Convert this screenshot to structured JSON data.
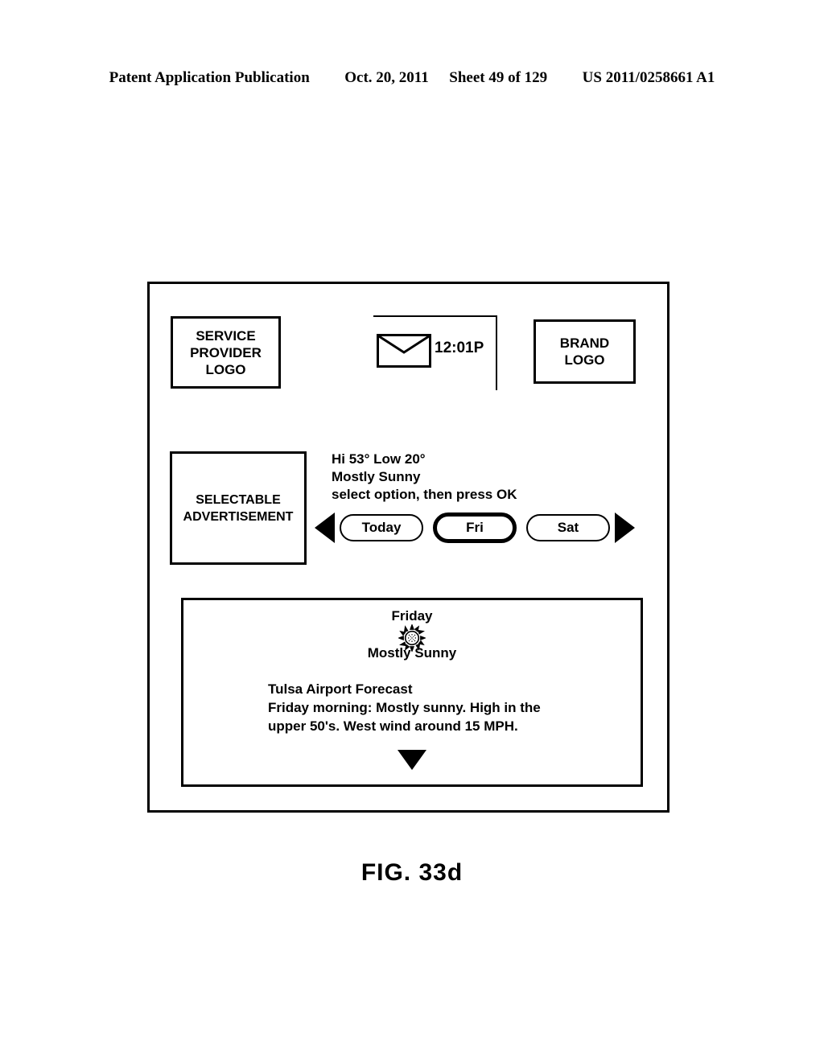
{
  "patent_header": {
    "publication": "Patent Application Publication",
    "date": "Oct. 20, 2011",
    "sheet": "Sheet 49 of 129",
    "number": "US 2011/0258661 A1"
  },
  "figure": {
    "caption": "FIG. 33d"
  },
  "screen": {
    "service_provider_logo": {
      "line1": "SERVICE",
      "line2": "PROVIDER",
      "line3": "LOGO"
    },
    "brand_logo": {
      "line1": "BRAND",
      "line2": "LOGO"
    },
    "status_bar": {
      "message_icon": "envelope-icon",
      "time": "12:01P"
    },
    "advertisement": {
      "line1": "SELECTABLE",
      "line2": "ADVERTISEMENT"
    },
    "weather_summary": {
      "temps": "Hi 53°  Low 20°",
      "conditions": "Mostly Sunny",
      "instruction": "select option, then press OK"
    },
    "day_selector": {
      "prev_arrow_icon": "triangle-left-icon",
      "next_arrow_icon": "triangle-right-icon",
      "options": [
        {
          "label": "Today",
          "selected": false
        },
        {
          "label": "Fri",
          "selected": true
        },
        {
          "label": "Sat",
          "selected": false
        }
      ]
    },
    "forecast_detail": {
      "day": "Friday",
      "weather_icon": "sun-icon",
      "conditions": "Mostly Sunny",
      "title": "Tulsa Airport Forecast",
      "body_line1": "Friday morning: Mostly sunny.  High in the",
      "body_line2": "upper 50's.  West wind around 15 MPH.",
      "scroll_icon": "triangle-down-icon"
    }
  },
  "colors": {
    "ink": "#000000",
    "paper": "#ffffff"
  }
}
